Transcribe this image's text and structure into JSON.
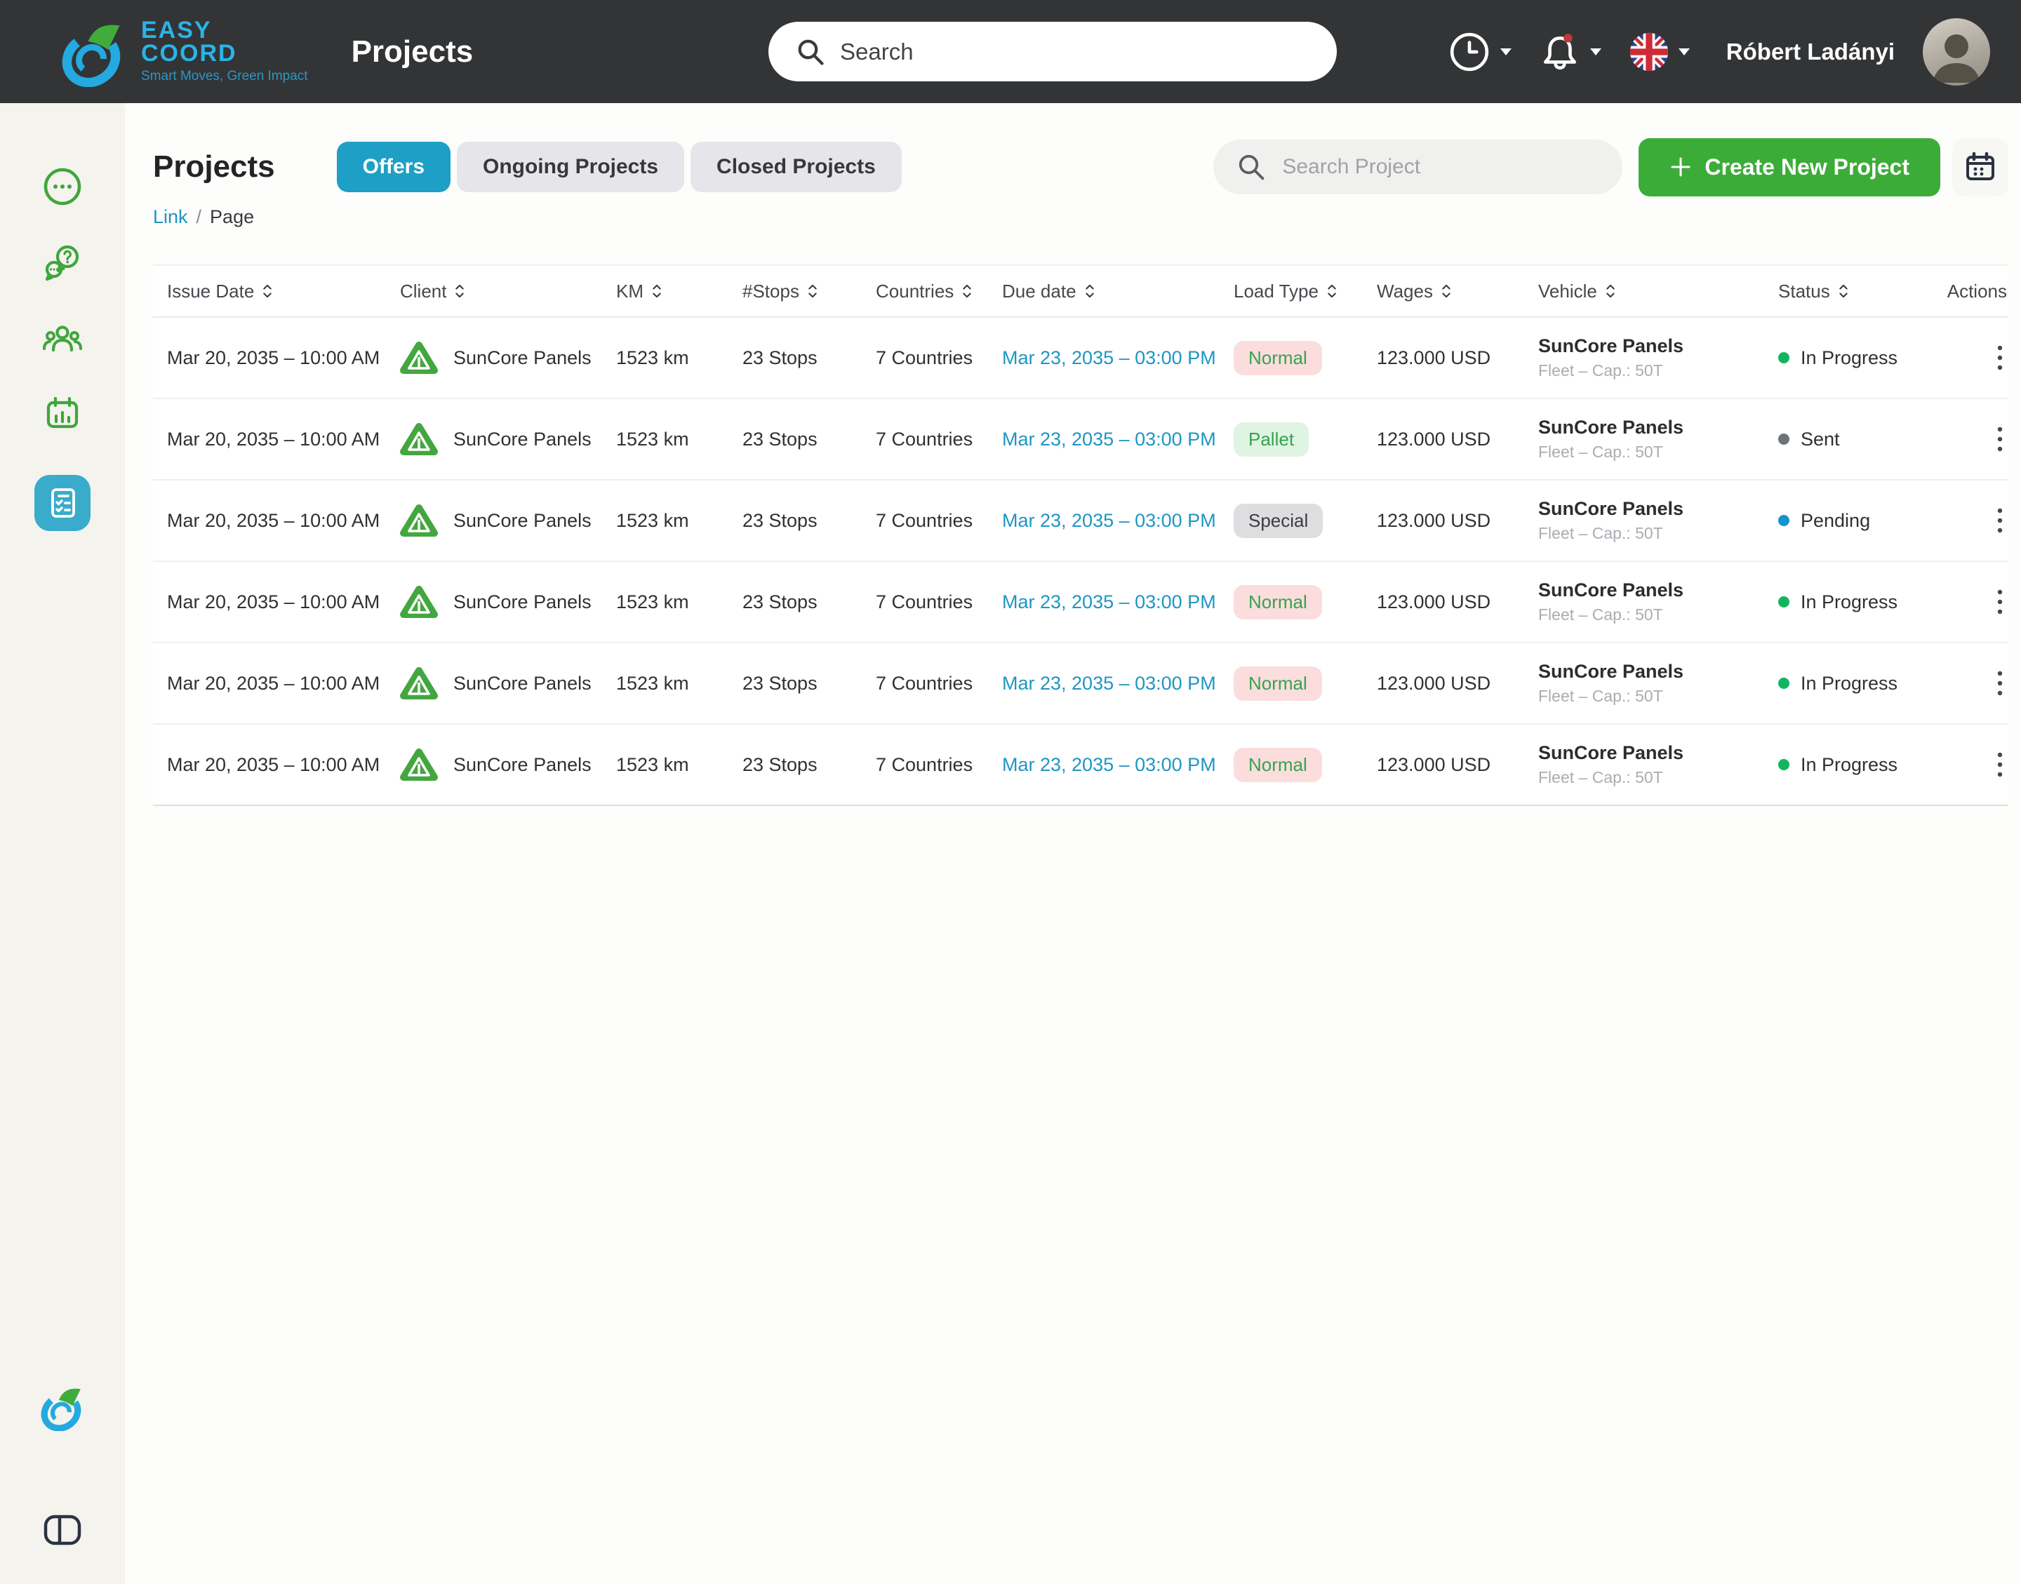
{
  "topbar": {
    "brand": {
      "line1": "EASY",
      "line2": "COORD",
      "tagline": "Smart Moves, Green Impact"
    },
    "page_title": "Projects",
    "search": {
      "placeholder": "Search"
    },
    "notifications": {
      "has_unread": true
    },
    "language": "en-GB",
    "user": {
      "name": "Róbert Ladányi"
    }
  },
  "sidebar": {
    "items": [
      {
        "icon": "more"
      },
      {
        "icon": "support-chat"
      },
      {
        "icon": "team"
      },
      {
        "icon": "calendar-stats"
      },
      {
        "icon": "projects-list",
        "active": true
      }
    ]
  },
  "page": {
    "title": "Projects",
    "tabs": [
      {
        "label": "Offers",
        "active": true
      },
      {
        "label": "Ongoing Projects",
        "active": false
      },
      {
        "label": "Closed Projects",
        "active": false
      }
    ],
    "breadcrumb": {
      "link": "Link",
      "separator": "/",
      "current": "Page"
    },
    "project_search": {
      "placeholder": "Search Project"
    },
    "create_button_label": "Create New Project"
  },
  "table": {
    "columns": [
      {
        "label": "Issue Date",
        "sortable": true
      },
      {
        "label": "Client",
        "sortable": true
      },
      {
        "label": "KM",
        "sortable": true
      },
      {
        "label": "#Stops",
        "sortable": true
      },
      {
        "label": "Countries",
        "sortable": true
      },
      {
        "label": "Due date",
        "sortable": true
      },
      {
        "label": "Load Type",
        "sortable": true
      },
      {
        "label": "Wages",
        "sortable": true
      },
      {
        "label": "Vehicle",
        "sortable": true
      },
      {
        "label": "Status",
        "sortable": true
      },
      {
        "label": "Actions",
        "sortable": false
      }
    ],
    "rows": [
      {
        "issue_date": "Mar 20, 2035 – 10:00 AM",
        "client": "SunCore Panels",
        "km": "1523 km",
        "stops": "23 Stops",
        "countries": "7 Countries",
        "due_date": "Mar 23, 2035 – 03:00 PM",
        "load_type": {
          "label": "Normal",
          "class": "badge badge-normal"
        },
        "wages": "123.000 USD",
        "vehicle": {
          "name": "SunCore Panels",
          "detail": "Fleet – Cap.: 50T"
        },
        "status": {
          "label": "In Progress",
          "dot_class": "dot dot-green"
        }
      },
      {
        "issue_date": "Mar 20, 2035 – 10:00 AM",
        "client": "SunCore Panels",
        "km": "1523 km",
        "stops": "23 Stops",
        "countries": "7 Countries",
        "due_date": "Mar 23, 2035 – 03:00 PM",
        "load_type": {
          "label": "Pallet",
          "class": "badge badge-pallet"
        },
        "wages": "123.000 USD",
        "vehicle": {
          "name": "SunCore Panels",
          "detail": "Fleet – Cap.: 50T"
        },
        "status": {
          "label": "Sent",
          "dot_class": "dot dot-gray"
        }
      },
      {
        "issue_date": "Mar 20, 2035 – 10:00 AM",
        "client": "SunCore Panels",
        "km": "1523 km",
        "stops": "23 Stops",
        "countries": "7 Countries",
        "due_date": "Mar 23, 2035 – 03:00 PM",
        "load_type": {
          "label": "Special",
          "class": "badge badge-special"
        },
        "wages": "123.000 USD",
        "vehicle": {
          "name": "SunCore Panels",
          "detail": "Fleet – Cap.: 50T"
        },
        "status": {
          "label": "Pending",
          "dot_class": "dot dot-blue"
        }
      },
      {
        "issue_date": "Mar 20, 2035 – 10:00 AM",
        "client": "SunCore Panels",
        "km": "1523 km",
        "stops": "23 Stops",
        "countries": "7 Countries",
        "due_date": "Mar 23, 2035 – 03:00 PM",
        "load_type": {
          "label": "Normal",
          "class": "badge badge-normal"
        },
        "wages": "123.000 USD",
        "vehicle": {
          "name": "SunCore Panels",
          "detail": "Fleet – Cap.: 50T"
        },
        "status": {
          "label": "In Progress",
          "dot_class": "dot dot-green"
        }
      },
      {
        "issue_date": "Mar 20, 2035 – 10:00 AM",
        "client": "SunCore Panels",
        "km": "1523 km",
        "stops": "23 Stops",
        "countries": "7 Countries",
        "due_date": "Mar 23, 2035 – 03:00 PM",
        "load_type": {
          "label": "Normal",
          "class": "badge badge-normal"
        },
        "wages": "123.000 USD",
        "vehicle": {
          "name": "SunCore Panels",
          "detail": "Fleet – Cap.: 50T"
        },
        "status": {
          "label": "In Progress",
          "dot_class": "dot dot-green"
        }
      },
      {
        "issue_date": "Mar 20, 2035 – 10:00 AM",
        "client": "SunCore Panels",
        "km": "1523 km",
        "stops": "23 Stops",
        "countries": "7 Countries",
        "due_date": "Mar 23, 2035 – 03:00 PM",
        "load_type": {
          "label": "Normal",
          "class": "badge badge-normal"
        },
        "wages": "123.000 USD",
        "vehicle": {
          "name": "SunCore Panels",
          "detail": "Fleet – Cap.: 50T"
        },
        "status": {
          "label": "In Progress",
          "dot_class": "dot dot-green"
        }
      }
    ]
  },
  "colors": {
    "topbar_bg": "#323436",
    "sidebar_bg": "#F4F3EE",
    "accent_teal": "#1E9FC6",
    "accent_green": "#3CAC39",
    "link": "#1E96C2",
    "badge_normal_bg": "#FBDDDE",
    "badge_normal_text": "#35A44C",
    "badge_pallet_bg": "#DFF4E3",
    "badge_pallet_text": "#35A44C",
    "badge_special_bg": "#DEDEE0",
    "status_in_progress": "#12B55F",
    "status_sent": "#6F7377",
    "status_pending": "#1792CE"
  }
}
